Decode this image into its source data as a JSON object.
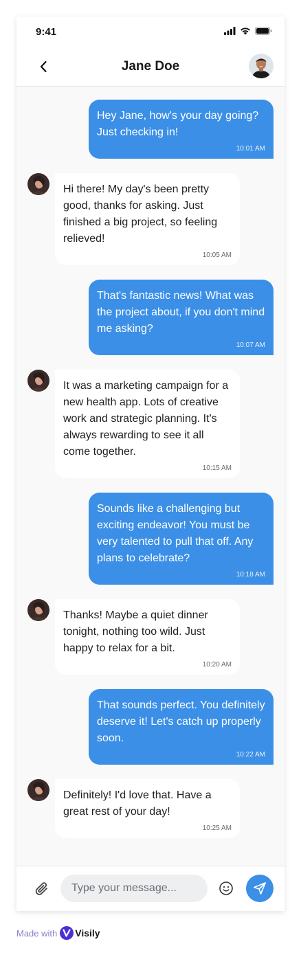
{
  "status_bar": {
    "time": "9:41"
  },
  "header": {
    "title": "Jane Doe"
  },
  "messages": [
    {
      "from": "me",
      "text": "Hey Jane, how's your day going? Just checking in!",
      "time": "10:01 AM"
    },
    {
      "from": "jane",
      "text": "Hi there! My day's been pretty good, thanks for asking. Just finished a big project, so feeling relieved!",
      "time": "10:05 AM"
    },
    {
      "from": "me",
      "text": "That's fantastic news! What was the project about, if you don't mind me asking?",
      "time": "10:07 AM"
    },
    {
      "from": "jane",
      "text": "It was a marketing campaign for a new health app. Lots of creative work and strategic planning. It's always rewarding to see it all come together.",
      "time": "10:15 AM"
    },
    {
      "from": "me",
      "text": "Sounds like a challenging but exciting endeavor! You must be very talented to pull that off. Any plans to celebrate?",
      "time": "10:18 AM"
    },
    {
      "from": "jane",
      "text": "Thanks! Maybe a quiet dinner tonight, nothing too wild. Just happy to relax for a bit.",
      "time": "10:20 AM"
    },
    {
      "from": "me",
      "text": "That sounds perfect. You definitely deserve it! Let's catch up properly soon.",
      "time": "10:22 AM"
    },
    {
      "from": "jane",
      "text": "Definitely! I'd love that. Have a great rest of your day!",
      "time": "10:25 AM"
    }
  ],
  "composer": {
    "placeholder": "Type your message..."
  },
  "footer": {
    "made_with": "Made with",
    "brand": "Visily"
  },
  "colors": {
    "accent": "#3b8fe6",
    "background": "#f9f9f9"
  },
  "icons": [
    "back-arrow-icon",
    "signal-icon",
    "wifi-icon",
    "battery-icon",
    "paperclip-icon",
    "smiley-icon",
    "send-icon"
  ]
}
